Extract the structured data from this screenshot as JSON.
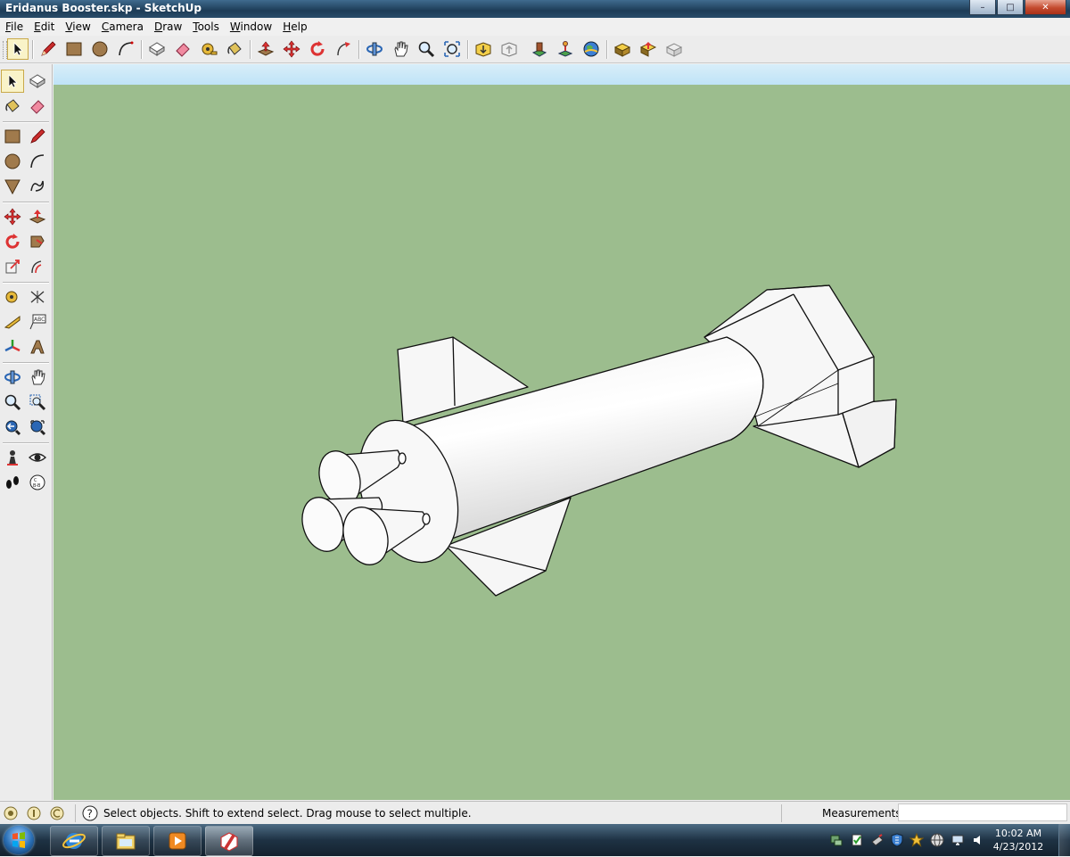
{
  "window": {
    "title": "Eridanus Booster.skp - SketchUp",
    "controls": {
      "minimize": "–",
      "maximize": "□",
      "close": "✕"
    }
  },
  "menu": [
    {
      "label": "File",
      "key": "F",
      "rest": "ile"
    },
    {
      "label": "Edit",
      "key": "E",
      "rest": "dit"
    },
    {
      "label": "View",
      "key": "V",
      "rest": "iew"
    },
    {
      "label": "Camera",
      "key": "C",
      "rest": "amera"
    },
    {
      "label": "Draw",
      "key": "D",
      "rest": "raw"
    },
    {
      "label": "Tools",
      "key": "T",
      "rest": "ools"
    },
    {
      "label": "Window",
      "key": "W",
      "rest": "indow"
    },
    {
      "label": "Help",
      "key": "H",
      "rest": "elp"
    }
  ],
  "top_toolbar": [
    "select-icon",
    "pencil-icon",
    "rectangle-icon",
    "circle-icon",
    "arc-icon",
    "make-component-icon",
    "eraser-icon",
    "tape-measure-icon",
    "paint-bucket-icon",
    "push-pull-icon",
    "move-icon",
    "rotate-icon",
    "follow-me-icon",
    "orbit-icon",
    "pan-icon",
    "zoom-icon",
    "zoom-extents-icon",
    "get-models-icon",
    "share-model-icon",
    "place-model-icon",
    "get-photo-icon",
    "google-earth-icon",
    "component-up-icon",
    "component-down-icon",
    "section-icon"
  ],
  "left_toolbar": [
    "select-icon",
    "make-component-icon",
    "paint-bucket-icon",
    "eraser-icon",
    "rectangle-icon",
    "line-icon",
    "circle-icon",
    "arc-icon",
    "polygon-icon",
    "freehand-icon",
    "move-icon",
    "push-pull-icon",
    "rotate-icon",
    "follow-me-icon",
    "scale-icon",
    "offset-icon",
    "tape-measure-icon",
    "dimension-icon",
    "protractor-icon",
    "text-icon",
    "axes-icon",
    "3d-text-icon",
    "orbit-icon",
    "pan-icon",
    "zoom-icon",
    "zoom-window-icon",
    "previous-view-icon",
    "zoom-extents-icon",
    "position-camera-icon",
    "look-around-icon",
    "walk-icon",
    "section-plane-icon"
  ],
  "status": {
    "hint": "Select objects. Shift to extend select. Drag mouse to select multiple.",
    "measurements_label": "Measurements",
    "measurements_value": "",
    "help_symbol": "?"
  },
  "taskbar": {
    "apps": [
      "internet-explorer-icon",
      "file-explorer-icon",
      "media-player-icon",
      "sketchup-icon"
    ],
    "active_app": "sketchup-icon",
    "clock_time": "10:02 AM",
    "clock_date": "4/23/2012"
  },
  "colors": {
    "viewport_ground": "#9cbd8e",
    "viewport_sky": "#c7e7f8",
    "model_face": "#f4f4f4",
    "model_shadow": "#d9d9d9"
  }
}
